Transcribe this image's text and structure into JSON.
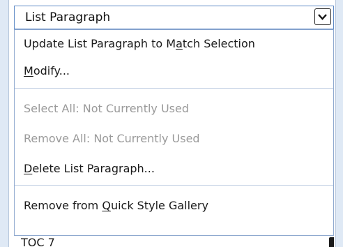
{
  "style_combo": {
    "selected": "List Paragraph"
  },
  "menu": {
    "update": {
      "pre": "Update List Paragraph to M",
      "key": "a",
      "post": "tch Selection"
    },
    "modify": {
      "key": "M",
      "post": "odify..."
    },
    "select_all": "Select All: Not Currently Used",
    "remove_all": "Remove All: Not Currently Used",
    "delete": {
      "key": "D",
      "post": "elete List Paragraph..."
    },
    "remove_gallery": {
      "pre": "Remove from ",
      "key": "Q",
      "post": "uick Style Gallery"
    }
  },
  "list_peek": {
    "label": "TOC 7"
  },
  "icons": {
    "combo_arrow": "chevron-down-icon"
  }
}
